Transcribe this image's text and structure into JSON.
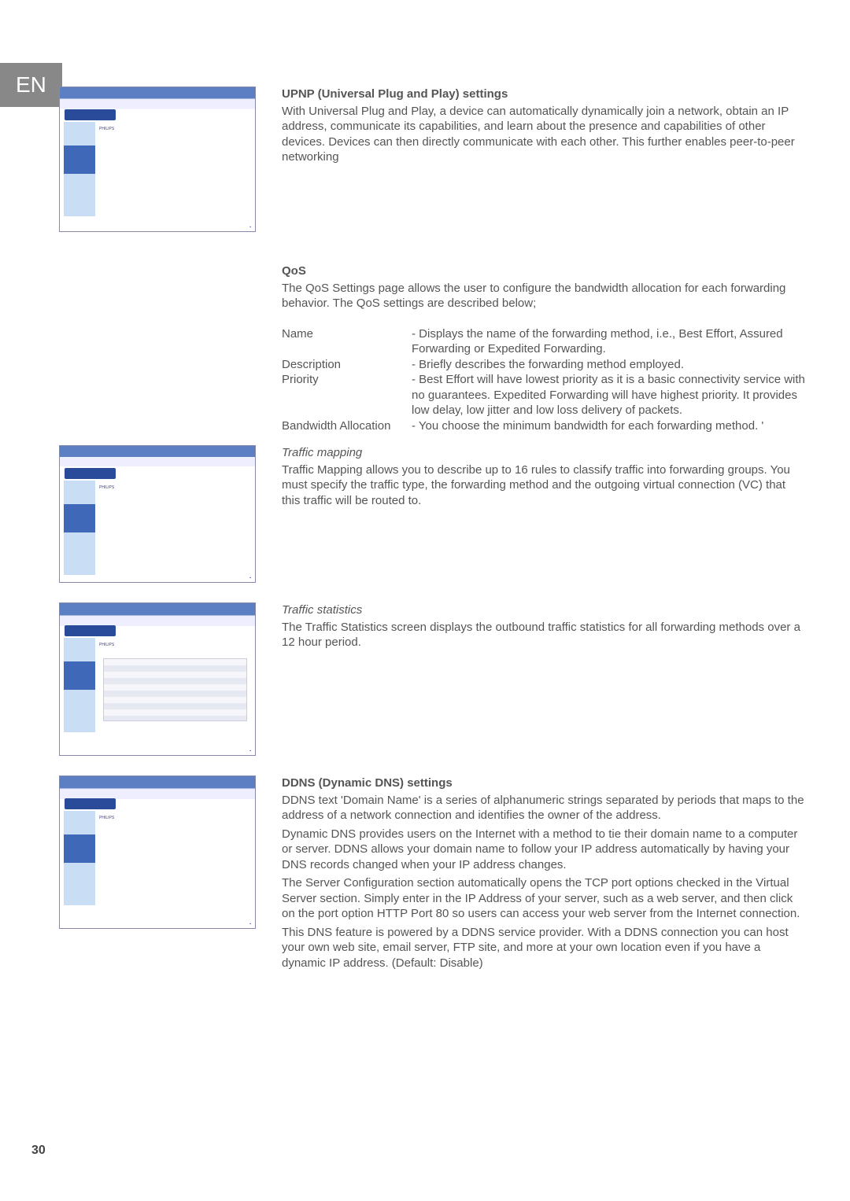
{
  "lang_badge": "EN",
  "page_number": "30",
  "upnp": {
    "heading": "UPNP (Universal Plug and Play) settings",
    "body": "With Universal Plug and Play, a device can automatically dynamically join a network, obtain an IP address, communicate its capabilities, and learn about the presence and capabilities of other devices. Devices can then directly communicate with each other. This further enables peer-to-peer networking"
  },
  "qos": {
    "heading": "QoS",
    "intro": "The QoS Settings page allows the user to configure the bandwidth allocation for each forwarding behavior. The QoS settings are described below;",
    "rows": [
      {
        "term": "Name",
        "val": "- Displays the name of the forwarding method, i.e., Best Effort, Assured Forwarding or Expedited Forwarding."
      },
      {
        "term": "Description",
        "val": "- Briefly describes the forwarding method employed."
      },
      {
        "term": "Priority",
        "val": "- Best Effort will have lowest priority as it is a basic connectivity service with no guarantees. Expedited Forwarding will have highest priority. It provides low delay, low jitter and low loss delivery of packets."
      },
      {
        "term": "Bandwidth Allocation",
        "val": "- You choose the minimum bandwidth for each forwarding method. '"
      }
    ]
  },
  "traffic_mapping": {
    "heading": "Traffic mapping",
    "body": "Traffic Mapping allows you to describe up to 16 rules to classify traffic into forwarding groups. You must specify the traffic type, the forwarding method and the outgoing virtual connection (VC) that this traffic will be routed to."
  },
  "traffic_stats": {
    "heading": "Traffic statistics",
    "body": "The Traffic Statistics screen displays the outbound traffic statistics for all forwarding methods over a 12 hour period."
  },
  "ddns": {
    "heading": "DDNS (Dynamic DNS) settings",
    "p1": "DDNS text 'Domain Name' is a series of alphanumeric strings separated by periods that maps to the address of a network connection and identifies the owner of the address.",
    "p2": "Dynamic DNS provides users on the Internet with a method to tie their domain name to a computer or server. DDNS allows your domain name to follow your IP address automatically by having your DNS records changed when your IP address changes.",
    "p3": "The Server Configuration section automatically opens the TCP port options checked in the Virtual Server section. Simply enter in the IP Address of your server, such as a web server, and then click on the port option HTTP Port 80 so users can access your web server from the Internet connection.",
    "p4": "This DNS feature is powered by a DDNS service provider. With a DDNS connection you can host your own web site, email server, FTP site, and more at your own location even if you have a dynamic IP address. (Default: Disable)"
  }
}
